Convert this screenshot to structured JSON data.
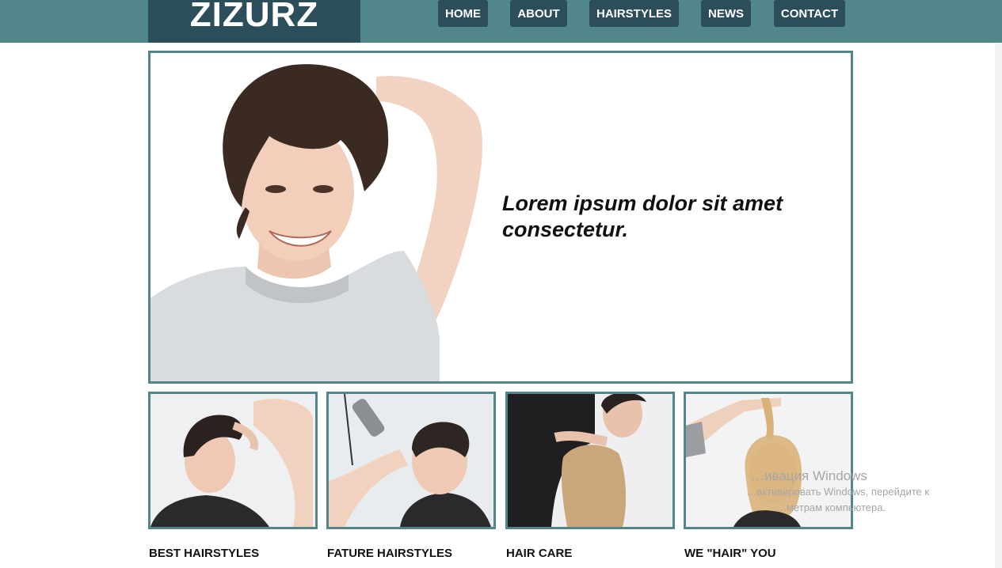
{
  "brand": {
    "logo": "ZIZURZ"
  },
  "nav": {
    "items": [
      {
        "label": "HOME"
      },
      {
        "label": "ABOUT"
      },
      {
        "label": "HAIRSTYLES"
      },
      {
        "label": "NEWS"
      },
      {
        "label": "CONTACT"
      }
    ]
  },
  "hero": {
    "headline": "Lorem ipsum dolor sit amet consectetur.",
    "image": "smiling-woman-short-hair-photo"
  },
  "features": [
    {
      "caption": "BEST HAIRSTYLES",
      "image": "man-styling-photo"
    },
    {
      "caption": "FATURE HAIRSTYLES",
      "image": "man-clipper-cut-photo"
    },
    {
      "caption": "HAIR CARE",
      "image": "hairdresser-cutting-long-hair-photo"
    },
    {
      "caption": "WE \"HAIR\" YOU",
      "image": "blonde-woman-hair-lift-photo"
    }
  ],
  "watermark": {
    "line1": "…ивация Windows",
    "line2": "…активировать Windows, перейдите к",
    "line3": "…метрам компьютера."
  },
  "colors": {
    "header_bg": "#51878b",
    "logo_bg": "#2c4d5a",
    "nav_button_bg": "#2c4d5a",
    "border": "#51878b"
  }
}
